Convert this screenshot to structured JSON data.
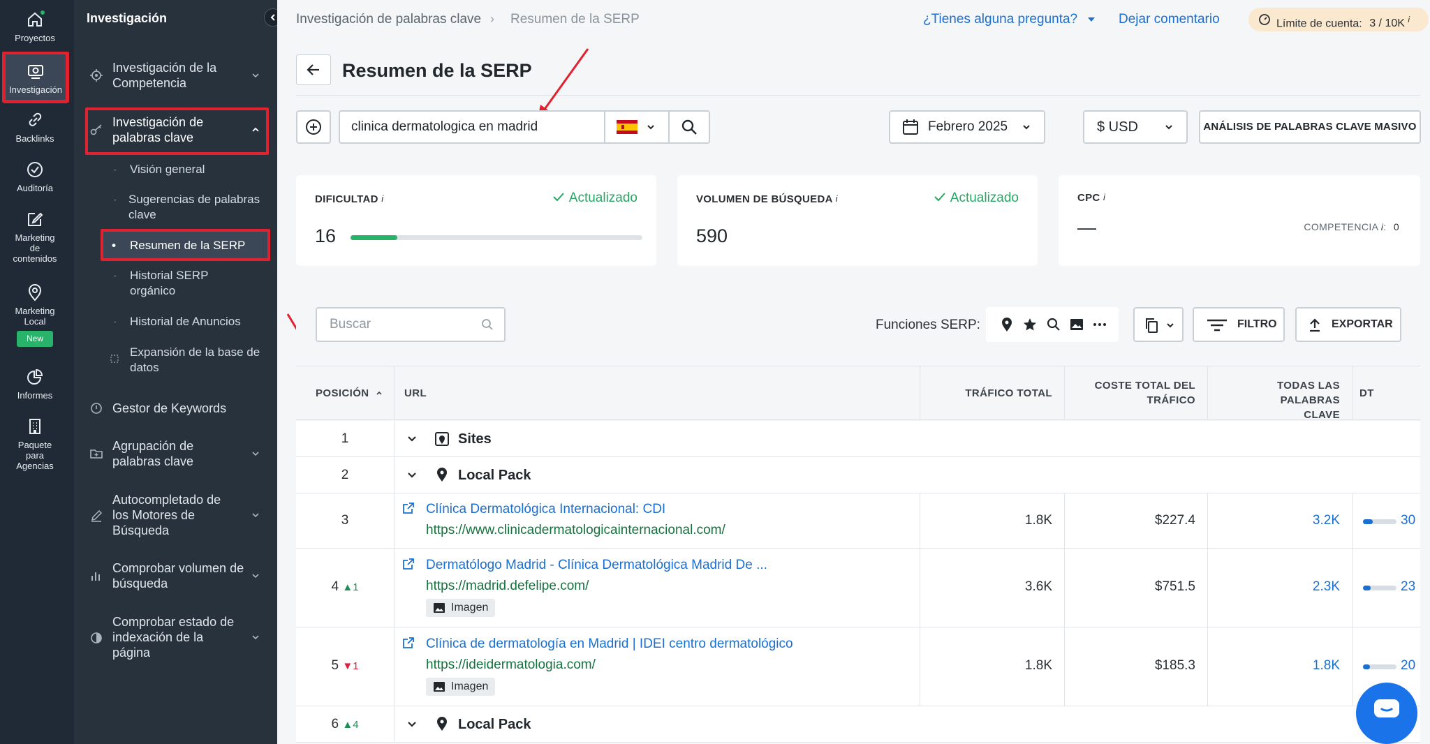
{
  "rail": {
    "items": [
      {
        "label": "Proyectos",
        "icon": "home-icon"
      },
      {
        "label": "Investigación",
        "icon": "research-icon",
        "active": true
      },
      {
        "label": "Backlinks",
        "icon": "link-icon"
      },
      {
        "label": "Auditoría",
        "icon": "check-circle-icon"
      },
      {
        "label": "Marketing de contenidos",
        "icon": "edit-icon"
      },
      {
        "label": "Marketing Local",
        "icon": "map-pin-icon",
        "badge": "New"
      },
      {
        "label": "Informes",
        "icon": "pie-chart-icon"
      },
      {
        "label": "Paquete para Agencias",
        "icon": "building-icon"
      }
    ]
  },
  "subnav": {
    "title": "Investigación",
    "sections": [
      {
        "label": "Investigación de la Competencia"
      },
      {
        "label": "Investigación de palabras clave",
        "expanded": true
      },
      {
        "label": "Gestor de Keywords"
      },
      {
        "label": "Agrupación de palabras clave"
      },
      {
        "label": "Autocompletado de los Motores de Búsqueda"
      },
      {
        "label": "Comprobar volumen de búsqueda"
      },
      {
        "label": "Comprobar estado de indexación de la página"
      }
    ],
    "subitems": [
      {
        "label": "Visión general"
      },
      {
        "label": "Sugerencias de palabras clave"
      },
      {
        "label": "Resumen de la SERP",
        "active": true
      },
      {
        "label": "Historial SERP orgánico"
      },
      {
        "label": "Historial de Anuncios"
      },
      {
        "label": "Expansión de la base de datos"
      }
    ]
  },
  "topbar": {
    "breadcrumb_parent": "Investigación de palabras clave",
    "breadcrumb_sep": "›",
    "breadcrumb_current": "Resumen de la SERP",
    "question_link": "¿Tienes alguna pregunta?",
    "feedback_link": "Dejar comentario",
    "limit_label": "Límite de cuenta:",
    "limit_value": "3 / 10K",
    "info_mark": "i"
  },
  "page": {
    "title": "Resumen de la SERP",
    "keyword": "clinica dermatologica en madrid",
    "date": "Febrero 2025",
    "currency": "$ USD",
    "bulk_button": "ANÁLISIS DE PALABRAS CLAVE MASIVO"
  },
  "cards": {
    "difficulty": {
      "label": "DIFICULTAD",
      "status": "Actualizado",
      "value": "16",
      "level": 0.16
    },
    "volume": {
      "label": "VOLUMEN DE BÚSQUEDA",
      "status": "Actualizado",
      "value": "590"
    },
    "cpc": {
      "label": "CPC",
      "value": "—",
      "competition_label": "COMPETENCIA",
      "competition_value": "0"
    }
  },
  "table": {
    "search_placeholder": "Buscar",
    "serp_features_label": "Funciones SERP:",
    "filter_button": "FILTRO",
    "export_button": "EXPORTAR",
    "headers": {
      "position": "POSICIÓN",
      "url": "URL",
      "traffic": "TRÁFICO TOTAL",
      "traffic_cost": "COSTE TOTAL DEL TRÁFICO",
      "keywords": "TODAS LAS PALABRAS CLAVE",
      "dt": "DT"
    },
    "rows": [
      {
        "position": "1",
        "group": "Sites"
      },
      {
        "position": "2",
        "group": "Local Pack"
      },
      {
        "position": "3",
        "title": "Clínica Dermatológica Internacional: CDI",
        "url": "https://www.clinicadermatologicainternacional.com/",
        "traffic": "1.8K",
        "cost": "$227.4",
        "keywords": "3.2K",
        "dt": "30",
        "dt_level": 0.3
      },
      {
        "position": "4",
        "change": "1",
        "change_dir": "up",
        "title": "Dermatólogo Madrid - Clínica Dermatológica Madrid De ...",
        "url": "https://madrid.defelipe.com/",
        "chip": "Imagen",
        "traffic": "3.6K",
        "cost": "$751.5",
        "keywords": "2.3K",
        "dt": "23",
        "dt_level": 0.23
      },
      {
        "position": "5",
        "change": "1",
        "change_dir": "down",
        "title": "Clínica de dermatología en Madrid | IDEI centro dermatológico",
        "url": "https://ideidermatologia.com/",
        "chip": "Imagen",
        "traffic": "1.8K",
        "cost": "$185.3",
        "keywords": "1.8K",
        "dt": "20",
        "dt_level": 0.2
      },
      {
        "position": "6",
        "change": "4",
        "change_dir": "up",
        "group": "Local Pack"
      }
    ]
  },
  "colors": {
    "accent": "#1a6fd1",
    "success": "#28b26a",
    "highlight": "#e0212f",
    "sidebar": "#1f2a36"
  }
}
